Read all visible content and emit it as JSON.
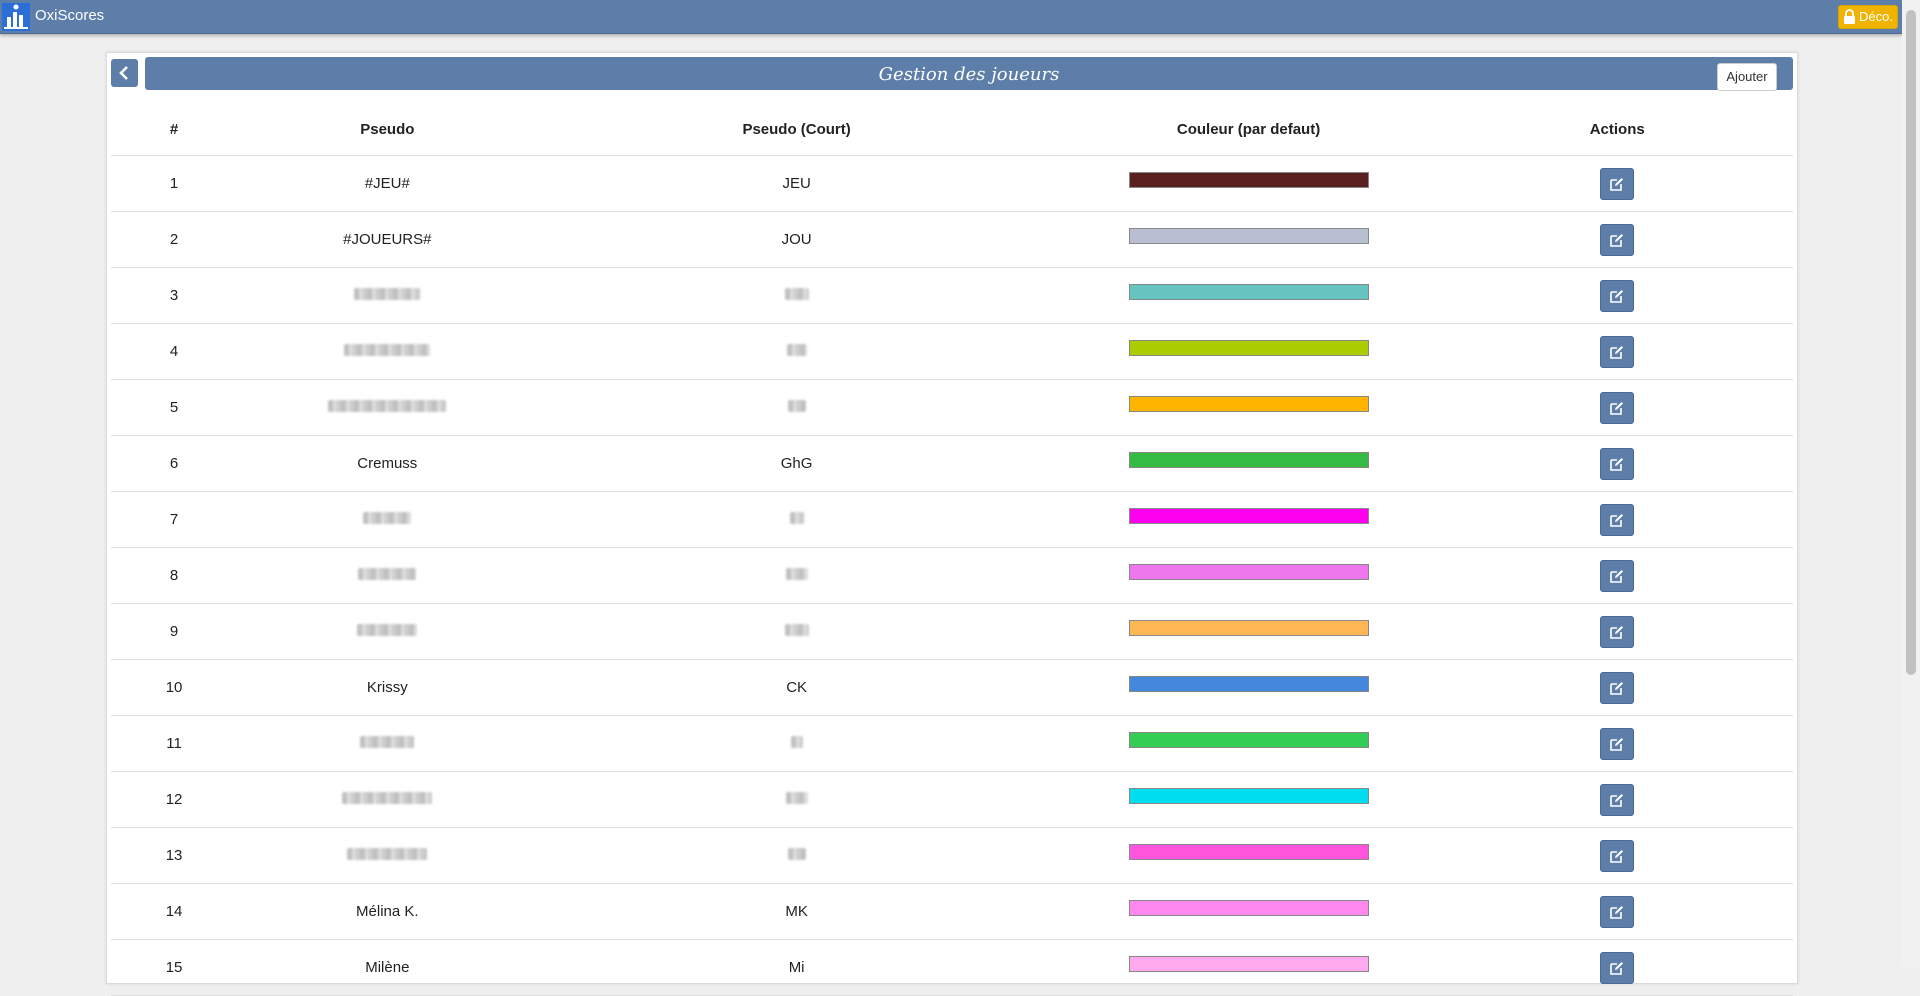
{
  "app": {
    "title": "OxiScores",
    "logout_label": "Déco."
  },
  "page": {
    "title": "Gestion des joueurs",
    "add_label": "Ajouter"
  },
  "table": {
    "headers": [
      "#",
      "Pseudo",
      "Pseudo (Court)",
      "Couleur (par defaut)",
      "Actions"
    ],
    "rows": [
      {
        "num": "1",
        "pseudo": "#JEU#",
        "short": "JEU",
        "color": "#5a1f1f"
      },
      {
        "num": "2",
        "pseudo": "#JOUEURS#",
        "short": "JOU",
        "color": "#b8bfd0"
      },
      {
        "num": "3",
        "pseudo": "",
        "short": "",
        "color": "#66c4c0"
      },
      {
        "num": "4",
        "pseudo": "",
        "short": "",
        "color": "#aacc00"
      },
      {
        "num": "5",
        "pseudo": "",
        "short": "",
        "color": "#ffb400"
      },
      {
        "num": "6",
        "pseudo": "Cremuss",
        "short": "GhG",
        "color": "#33bb44"
      },
      {
        "num": "7",
        "pseudo": "",
        "short": "",
        "color": "#ff00ee"
      },
      {
        "num": "8",
        "pseudo": "",
        "short": "",
        "color": "#ee77ee"
      },
      {
        "num": "9",
        "pseudo": "",
        "short": "",
        "color": "#ffb655"
      },
      {
        "num": "10",
        "pseudo": "Krissy",
        "short": "CK",
        "color": "#4488dd"
      },
      {
        "num": "11",
        "pseudo": "",
        "short": "",
        "color": "#33cc55"
      },
      {
        "num": "12",
        "pseudo": "",
        "short": "",
        "color": "#00ddee"
      },
      {
        "num": "13",
        "pseudo": "",
        "short": "",
        "color": "#ff55dd"
      },
      {
        "num": "14",
        "pseudo": "Mélina K.",
        "short": "MK",
        "color": "#ff88ee"
      },
      {
        "num": "15",
        "pseudo": "Milène",
        "short": "Mi",
        "color": "#ffaaee"
      }
    ]
  },
  "icons": {
    "logo": "chart-logo-icon",
    "lock": "lock-icon",
    "back": "chevron-left-icon",
    "edit": "edit-icon"
  },
  "colors": {
    "accent": "#5d7ea8",
    "logout": "#f0b400"
  }
}
